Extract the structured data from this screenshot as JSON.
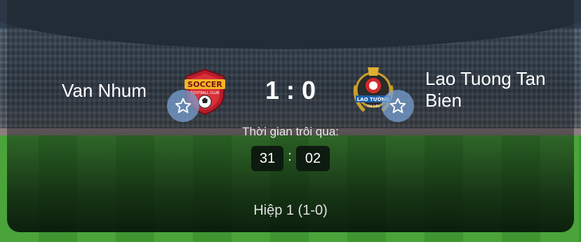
{
  "match": {
    "home_team": "Van Nhum",
    "away_team": "Lao Tuong Tan Bien",
    "score": "1 : 0",
    "elapsed_label": "Thời gian trôi qua:",
    "elapsed_minutes": "31",
    "elapsed_separator": ":",
    "elapsed_seconds": "02",
    "period": "Hiệp 1 (1-0)"
  },
  "logos": {
    "home_text_top": "SOCCER",
    "home_text_bottom": "FOOTBALL CLUB",
    "away_text": "LAO TƯỜNG",
    "away_text_bottom": "TÂN BIÊN"
  },
  "icons": {
    "favorite": "star-outline-icon"
  },
  "colors": {
    "favorite_bg": "#78a0d2",
    "timer_bg": "#0d1a10",
    "text": "#ffffff"
  }
}
